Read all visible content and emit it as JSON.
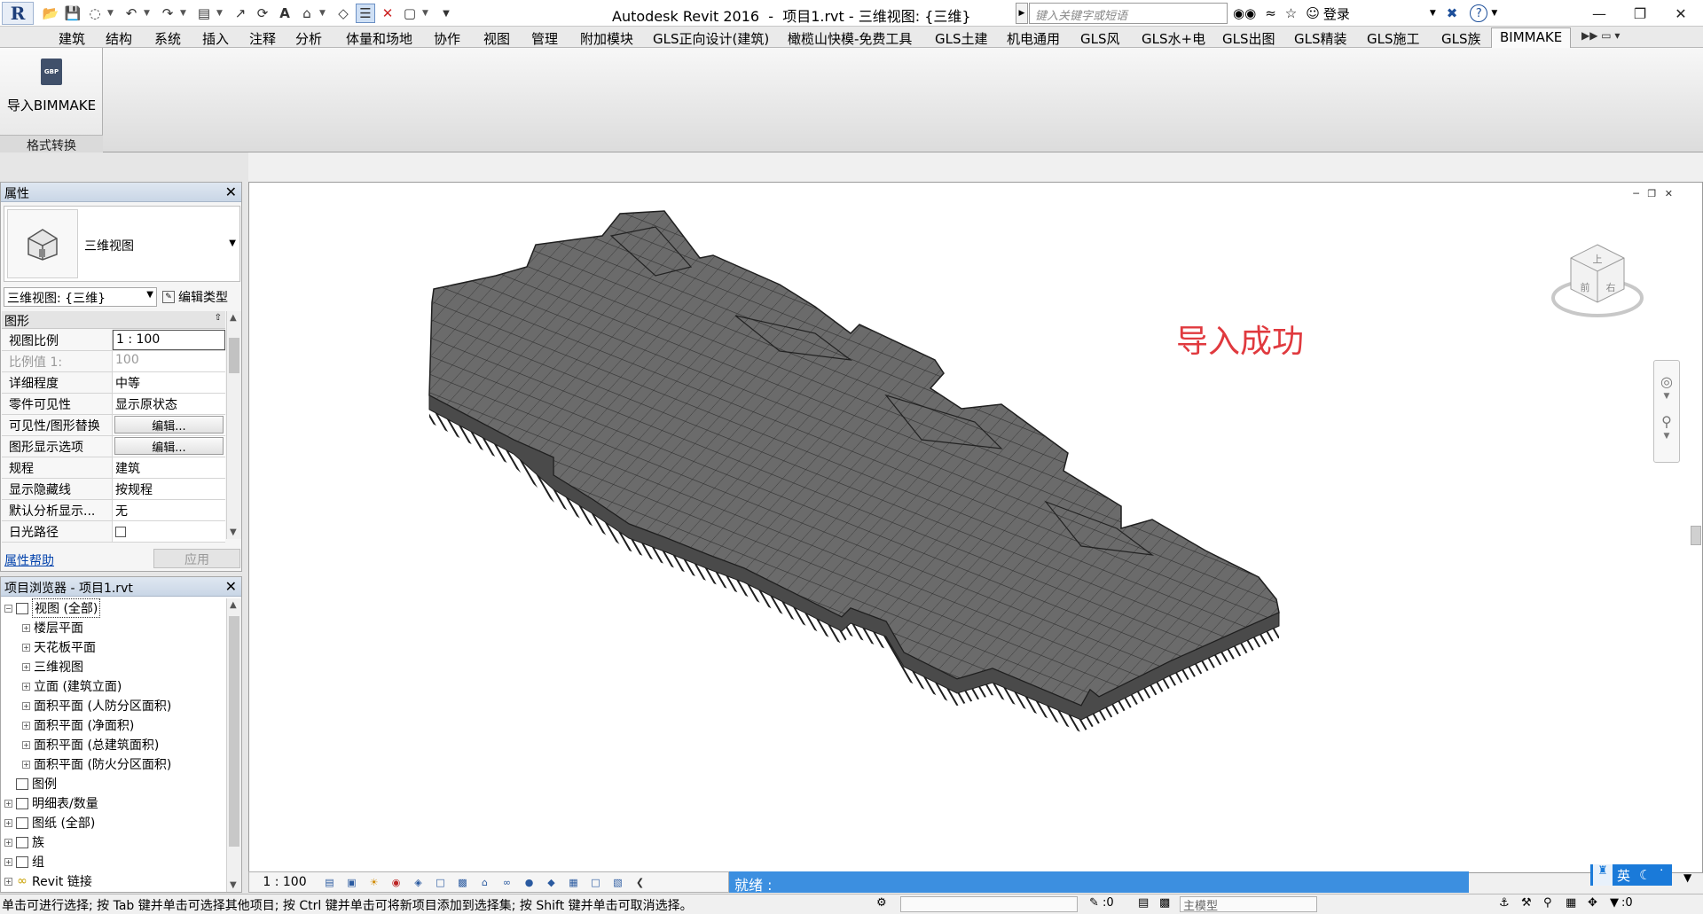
{
  "window": {
    "title": "Autodesk Revit 2016  -  项目1.rvt - 三维视图: {三维}",
    "search_placeholder": "键入关键字或短语",
    "login": "登录"
  },
  "ribbon_tabs": [
    {
      "label": "建筑",
      "active": false
    },
    {
      "label": "结构",
      "active": false
    },
    {
      "label": "系统",
      "active": false
    },
    {
      "label": "插入",
      "active": false
    },
    {
      "label": "注释",
      "active": false
    },
    {
      "label": "分析",
      "active": false
    },
    {
      "label": "体量和场地",
      "active": false
    },
    {
      "label": "协作",
      "active": false
    },
    {
      "label": "视图",
      "active": false
    },
    {
      "label": "管理",
      "active": false
    },
    {
      "label": "附加模块",
      "active": false
    },
    {
      "label": "GLS正向设计(建筑)",
      "active": false
    },
    {
      "label": "橄榄山快模-免费工具",
      "active": false
    },
    {
      "label": "GLS土建",
      "active": false
    },
    {
      "label": "机电通用",
      "active": false
    },
    {
      "label": "GLS风",
      "active": false
    },
    {
      "label": "GLS水+电",
      "active": false
    },
    {
      "label": "GLS出图",
      "active": false
    },
    {
      "label": "GLS精装",
      "active": false
    },
    {
      "label": "GLS施工",
      "active": false
    },
    {
      "label": "GLS族",
      "active": false
    },
    {
      "label": "BIMMAKE",
      "active": true
    }
  ],
  "ribbon_panel": {
    "button_label": "导入BIMMAKE",
    "icon_text": "GBP",
    "panel_title": "格式转换"
  },
  "properties": {
    "title": "属性",
    "type_name": "三维视图",
    "view_filter": "三维视图: {三维}",
    "edit_type": "编辑类型",
    "group": "图形",
    "rows": [
      {
        "key": "视图比例",
        "value": "1 : 100"
      },
      {
        "key": "比例值 1:",
        "value": "100"
      },
      {
        "key": "详细程度",
        "value": "中等"
      },
      {
        "key": "零件可见性",
        "value": "显示原状态"
      },
      {
        "key": "可见性/图形替换",
        "value": "编辑..."
      },
      {
        "key": "图形显示选项",
        "value": "编辑..."
      },
      {
        "key": "规程",
        "value": "建筑"
      },
      {
        "key": "显示隐藏线",
        "value": "按规程"
      },
      {
        "key": "默认分析显示...",
        "value": "无"
      },
      {
        "key": "日光路径",
        "value": ""
      }
    ],
    "help_link": "属性帮助",
    "apply": "应用"
  },
  "browser": {
    "title": "项目浏览器 - 项目1.rvt",
    "nodes": [
      {
        "label": "视图 (全部)",
        "level": 0
      },
      {
        "label": "楼层平面",
        "level": 1
      },
      {
        "label": "天花板平面",
        "level": 1
      },
      {
        "label": "三维视图",
        "level": 1
      },
      {
        "label": "立面 (建筑立面)",
        "level": 1
      },
      {
        "label": "面积平面 (人防分区面积)",
        "level": 1
      },
      {
        "label": "面积平面 (净面积)",
        "level": 1
      },
      {
        "label": "面积平面 (总建筑面积)",
        "level": 1
      },
      {
        "label": "面积平面 (防火分区面积)",
        "level": 1
      },
      {
        "label": "图例",
        "level": 0
      },
      {
        "label": "明细表/数量",
        "level": 0
      },
      {
        "label": "图纸 (全部)",
        "level": 0
      },
      {
        "label": "族",
        "level": 0
      },
      {
        "label": "组",
        "level": 0
      },
      {
        "label": "Revit 链接",
        "level": 0
      }
    ]
  },
  "canvas": {
    "message": "导入成功",
    "viewcube_top": "上",
    "viewcube_front": "前",
    "viewcube_right": "右",
    "model_color": "#6b6b6b",
    "message_color": "#e0393e"
  },
  "view_bar": {
    "scale": "1 : 100",
    "ready": "就绪 :"
  },
  "ime": {
    "lang": "英"
  },
  "status": {
    "hint": "单击可进行选择; 按 Tab 键并单击可选择其他项目; 按 Ctrl 键并单击可将新项目添加到选择集; 按 Shift 键并单击可取消选择。",
    "counter": ":0",
    "model": "主模型",
    "filter_count": ":0"
  }
}
